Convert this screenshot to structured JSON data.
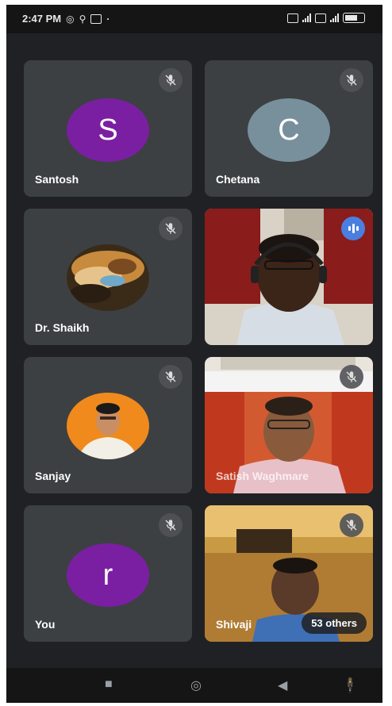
{
  "status_bar": {
    "time": "2:47 PM",
    "icons": [
      "whatsapp-icon",
      "location-icon",
      "notification-icon",
      "more-dot-icon",
      "sim1-icon",
      "signal-icon",
      "sim2-icon",
      "signal-icon",
      "battery-icon"
    ]
  },
  "participants": [
    {
      "name": "Santosh",
      "initial": "S",
      "avatar_color": "#7b1fa2",
      "muted": true,
      "type": "initial"
    },
    {
      "name": "Chetana",
      "initial": "C",
      "avatar_color": "#78909c",
      "muted": true,
      "type": "initial"
    },
    {
      "name": "Dr. Shaikh",
      "muted": true,
      "type": "photo"
    },
    {
      "name": "",
      "muted": false,
      "speaking": true,
      "type": "video"
    },
    {
      "name": "Sanjay",
      "muted": true,
      "type": "photo"
    },
    {
      "name": "Satish Waghmare",
      "muted": true,
      "type": "video"
    },
    {
      "name": "You",
      "initial": "r",
      "avatar_color": "#7b1fa2",
      "muted": true,
      "type": "initial"
    },
    {
      "name": "Shivaji",
      "muted": true,
      "type": "video"
    }
  ],
  "others_badge": "53 others",
  "nav_bar": {
    "buttons": [
      "recents-icon",
      "home-icon",
      "back-icon",
      "accessibility-icon"
    ]
  },
  "colors": {
    "background": "#202124",
    "tile": "#3c4043",
    "speaking_indicator": "#4a7fe0"
  }
}
